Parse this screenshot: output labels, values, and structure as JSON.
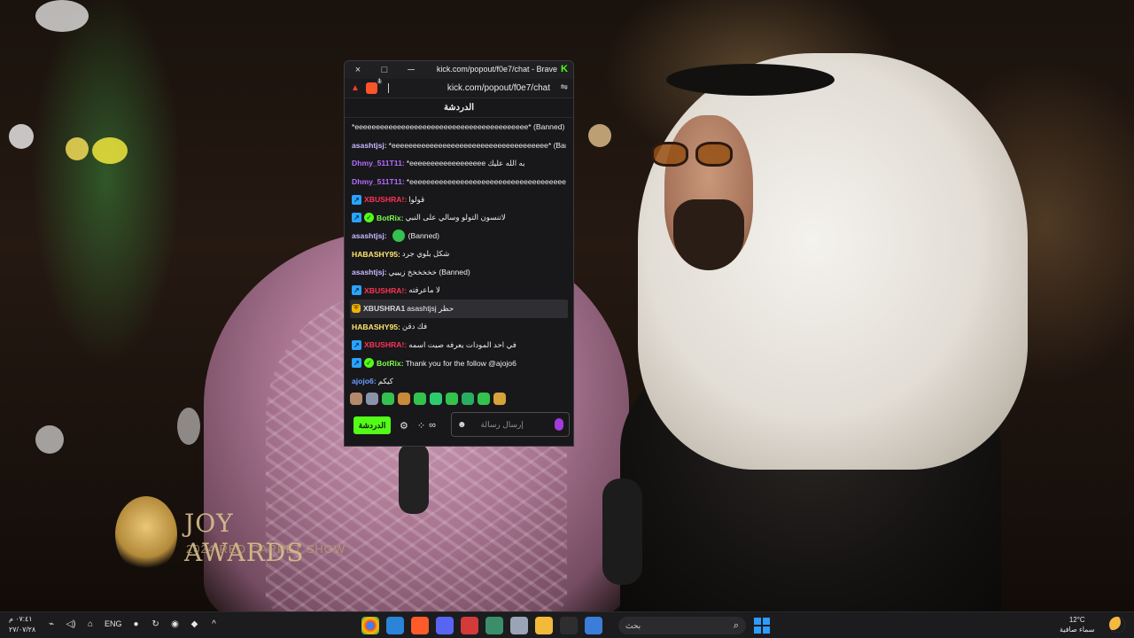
{
  "browser": {
    "title": "kick.com/popout/f0e7/chat - Brave",
    "url": "kick.com/popout/f0e7/chat",
    "close_icon": "×",
    "maximize_icon": "□",
    "minimize_icon": "─"
  },
  "chat": {
    "header": "الدردشة",
    "messages": [
      {
        "user": "",
        "color": "#ffffff",
        "badges": [],
        "text": "*eeeeeeeeeeeeeeeeeeeeeeeeeeeeeeeeeeeeeeeee* (Banned)"
      },
      {
        "user": "asashtjsj:",
        "color": "#c9b8ff",
        "badges": [],
        "text": "*eeeeeeeeeeeeeeeeeeeeeeeeeeeeeeeeeeeee* (Banned)"
      },
      {
        "user": "Dhmy_511T11:",
        "color": "#b46cff",
        "badges": [],
        "text": "*eeeeeeeeeeeeeeeeee به الله عليك"
      },
      {
        "user": "Dhmy_511T11:",
        "color": "#b46cff",
        "badges": [],
        "text": "*eeeeeeeeeeeeeeeeeeeeeeeeeeeeeeeeeeeeeeeeeeeeeee"
      },
      {
        "user": "XBUSHRA!:",
        "color": "#ff3355",
        "badges": [
          "sq"
        ],
        "text": "قولوا"
      },
      {
        "user": "BotRix:",
        "color": "#7dff4a",
        "badges": [
          "sq",
          "ok"
        ],
        "text": "لاتنسون التولو وسالي على النبي"
      },
      {
        "user": "asashtjsj:",
        "color": "#c9b8ff",
        "badges": [],
        "text": "(Banned)",
        "emote": true
      },
      {
        "user": "HABASHY95:",
        "color": "#ffe66b",
        "badges": [],
        "text": "شكل بلوي جرد"
      },
      {
        "user": "asashtjsj:",
        "color": "#c9b8ff",
        "badges": [],
        "text": "خخخخخخ زيييي (Banned)"
      },
      {
        "user": "XBUSHRA!:",
        "color": "#ff3355",
        "badges": [
          "sq"
        ],
        "text": "لا ماعرفته"
      },
      {
        "user": "XBUSHRA1",
        "color": "#d8d8d8",
        "badges": [
          "mod"
        ],
        "text": "asashtjsj حظر",
        "highlight": true
      },
      {
        "user": "HABASHY95:",
        "color": "#ffe66b",
        "badges": [],
        "text": "فك دقن"
      },
      {
        "user": "XBUSHRA!:",
        "color": "#ff3355",
        "badges": [
          "sq"
        ],
        "text": "في احد المودات يعرفه صيت اسمه"
      },
      {
        "user": "BotRix:",
        "color": "#7dff4a",
        "badges": [
          "sq",
          "ok"
        ],
        "text": "Thank you for the follow @ajojo6"
      },
      {
        "user": "ajojo6:",
        "color": "#6c9cff",
        "badges": [],
        "text": "كيكم"
      }
    ],
    "emote_colors": [
      "#b58a6a",
      "#8a93a8",
      "#33c24d",
      "#c98a3a",
      "#33c24d",
      "#2ecc71",
      "#33c24d",
      "#27ae60",
      "#33c24d",
      "#d6a33a"
    ],
    "compose": {
      "send_label": "الدردشة",
      "placeholder": "إرسال رسالة",
      "settings_icon": "⚙",
      "infinity_icon": "∞",
      "smile_icon": "☻"
    }
  },
  "stream_overlay": {
    "logo_title": "JOY AWARDS",
    "logo_sub": "2024 RED CARPET SHOW"
  },
  "taskbar": {
    "clock_time": "٠٧:٤١ م",
    "clock_date": "٢٧/٠٧/٢٨",
    "language": "ENG",
    "search_placeholder": "بحث",
    "search_icon": "⌕",
    "weather_temp": "12°C",
    "weather_desc": "سماء صافية",
    "tray_up_icon": "^",
    "app_colors": [
      "#ffffff",
      "#2a84d8",
      "#ff5a2a",
      "#5865f2",
      "#d33a3a",
      "#3a8f6a",
      "#9aa3b8",
      "#f2b93b",
      "#2e2e2e",
      "#3b7dd8"
    ]
  }
}
